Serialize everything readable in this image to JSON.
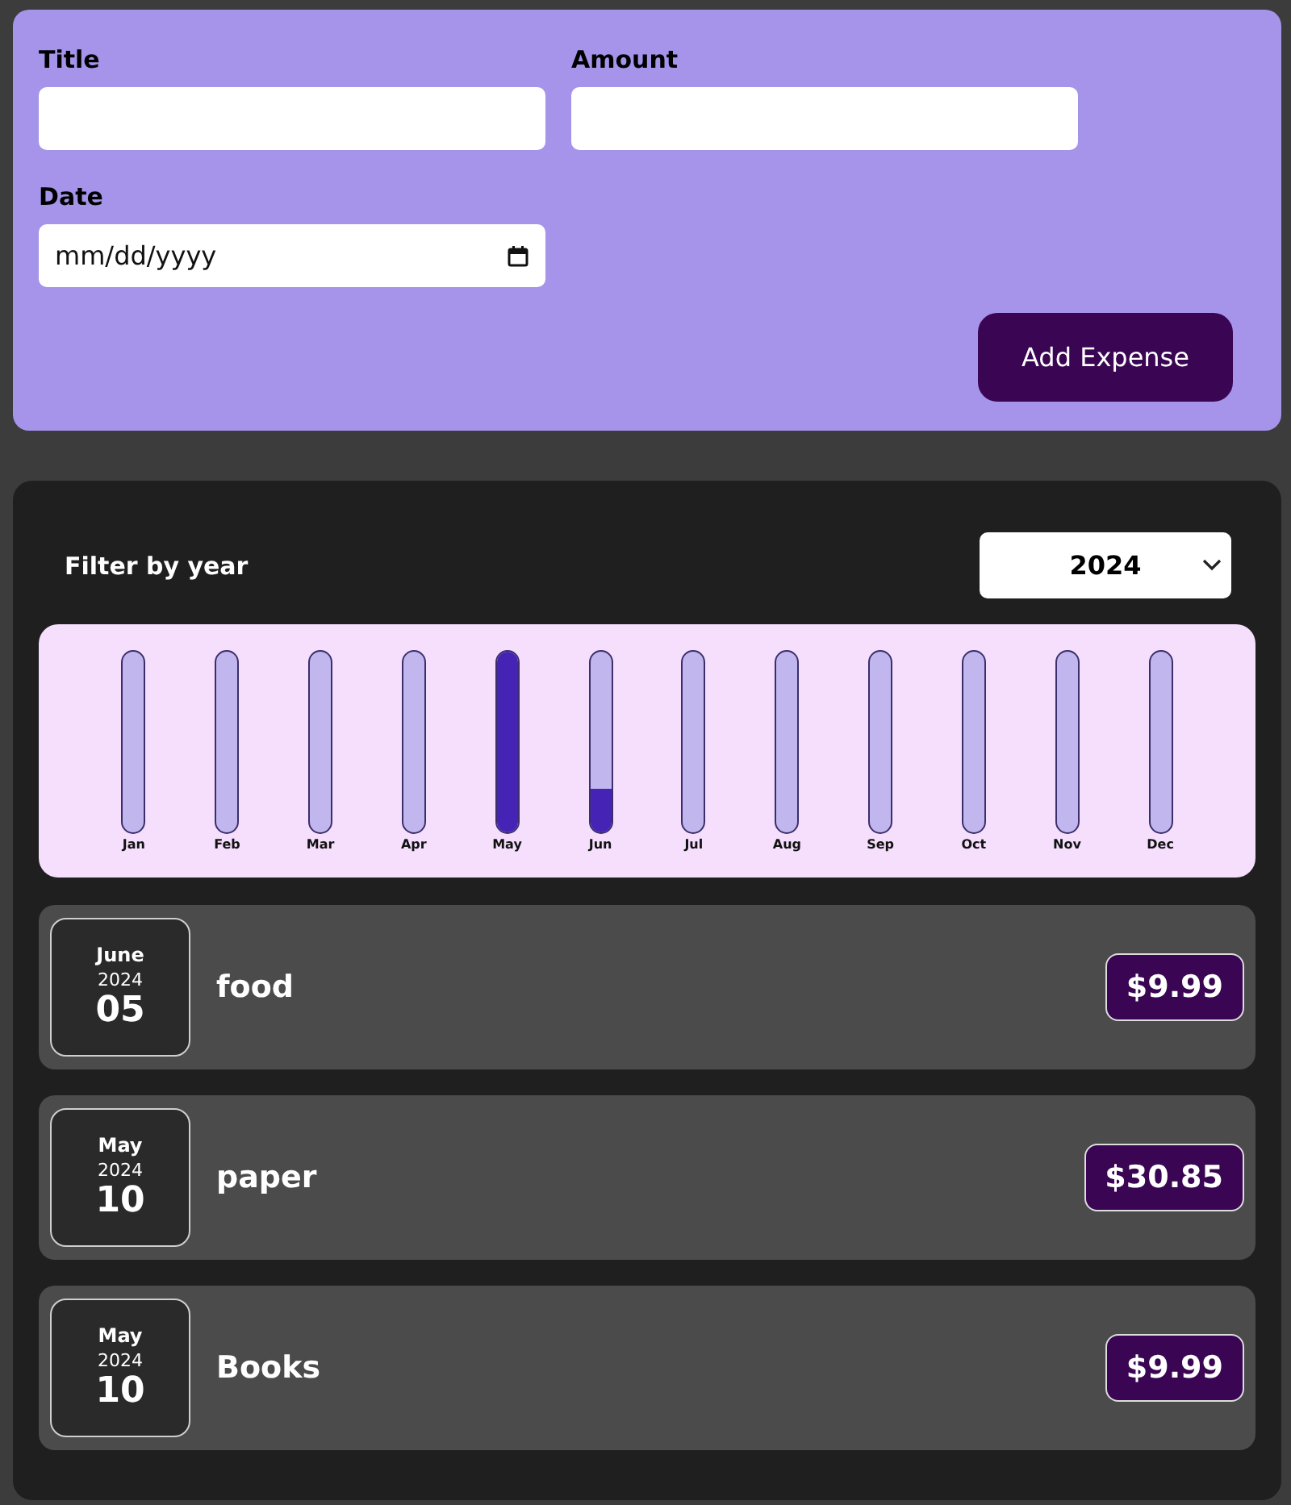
{
  "form": {
    "fields": [
      {
        "kind": "text",
        "label": "Title"
      },
      {
        "kind": "text",
        "label": "Amount"
      },
      {
        "kind": "date",
        "label": "Date",
        "placeholder": "mm/dd/yyyy"
      }
    ],
    "submit_button": "Add Expense"
  },
  "filter": {
    "label": "Filter by year",
    "selected_year": "2024"
  },
  "months": [
    {
      "label": "Jan",
      "level": 0
    },
    {
      "label": "Feb",
      "level": 0
    },
    {
      "label": "Mar",
      "level": 0
    },
    {
      "label": "Apr",
      "level": 0
    },
    {
      "label": "May",
      "level": 1
    },
    {
      "label": "Jun",
      "level": 0.24
    },
    {
      "label": "Jul",
      "level": 0
    },
    {
      "label": "Aug",
      "level": 0
    },
    {
      "label": "Sep",
      "level": 0
    },
    {
      "label": "Oct",
      "level": 0
    },
    {
      "label": "Nov",
      "level": 0
    },
    {
      "label": "Dec",
      "level": 0
    }
  ],
  "expenses": [
    {
      "month": "June",
      "year": "2024",
      "day": "05",
      "title": "food",
      "amount": "$9.99"
    },
    {
      "month": "May",
      "year": "2024",
      "day": "10",
      "title": "paper",
      "amount": "$30.85"
    },
    {
      "month": "May",
      "year": "2024",
      "day": "10",
      "title": "Books",
      "amount": "$9.99"
    }
  ]
}
